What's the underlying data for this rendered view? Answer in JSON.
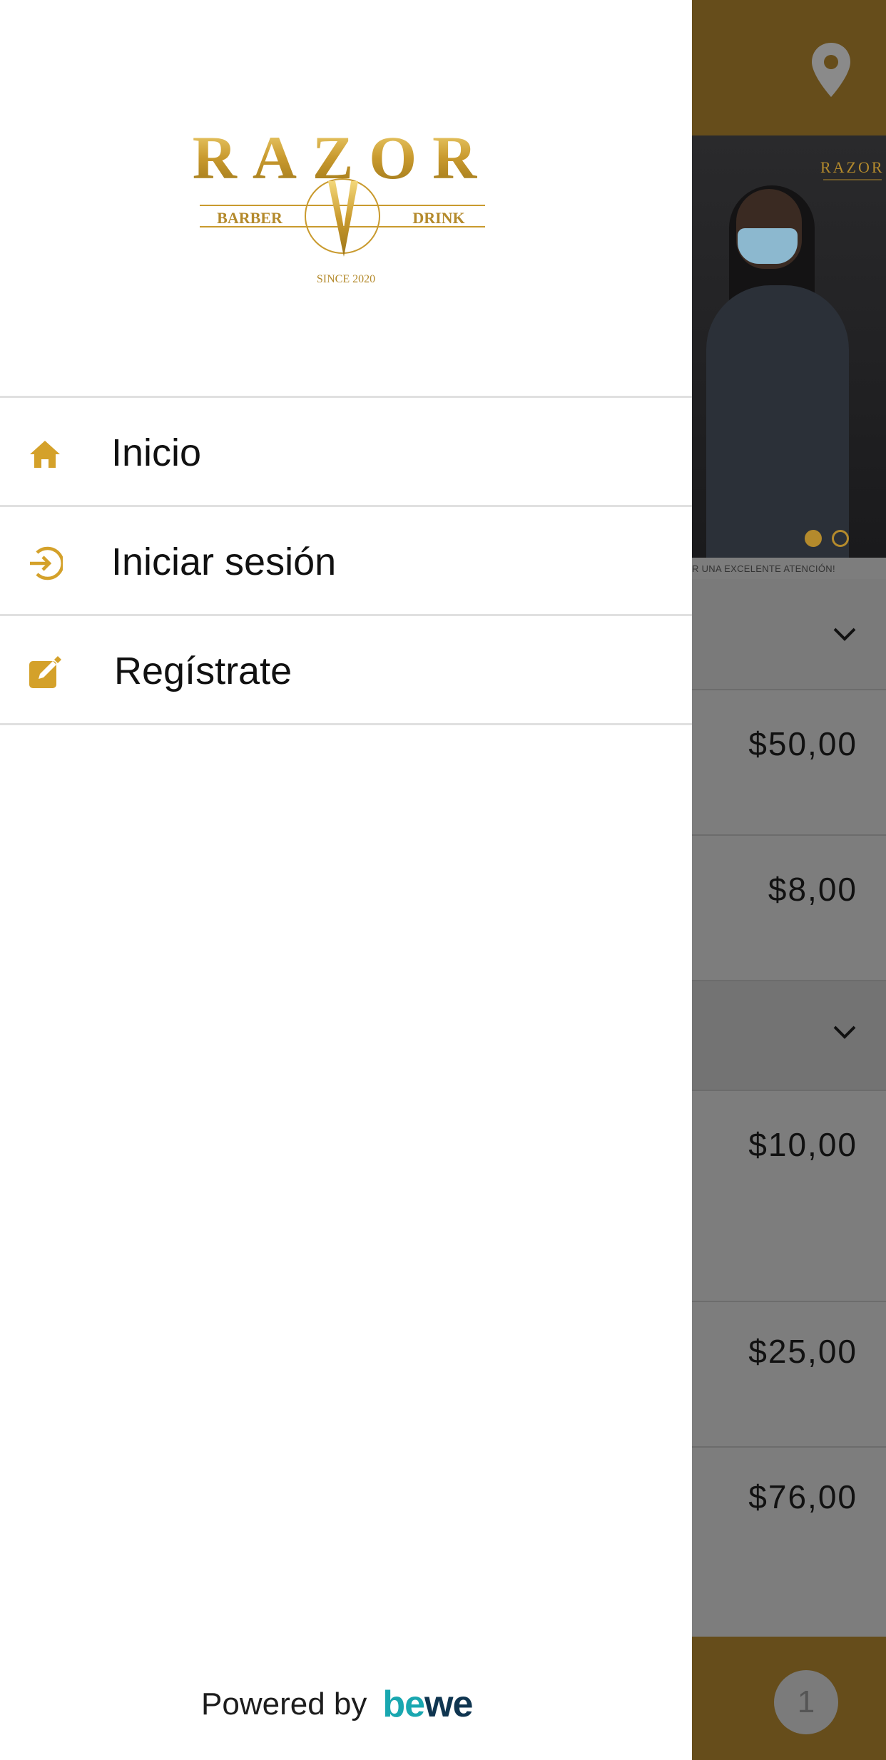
{
  "background_app": {
    "hero_caption": "R UNA EXCELENTE ATENCIÓN!",
    "hero_logo_text": "RAZOR",
    "carousel": {
      "total": 2,
      "active": 1
    },
    "prices": [
      "$50,00",
      "$8,00",
      "$10,00",
      "$25,00",
      "$76,00"
    ],
    "cart_count": "1",
    "colors": {
      "header": "#664d1b",
      "accent": "#b48a2c"
    }
  },
  "drawer": {
    "logo": {
      "wordmark": "RAZOR",
      "left_text": "BARBER",
      "right_text": "DRINK",
      "since_text": "SINCE 2020"
    },
    "menu": [
      {
        "label": "Inicio",
        "icon": "home-icon"
      },
      {
        "label": "Iniciar sesión",
        "icon": "login-icon"
      },
      {
        "label": "Regístrate",
        "icon": "edit-icon"
      }
    ],
    "footer": {
      "powered_by": "Powered by",
      "brand_part1": "be",
      "brand_part2": "we"
    },
    "accent_color": "#d4a12a"
  }
}
